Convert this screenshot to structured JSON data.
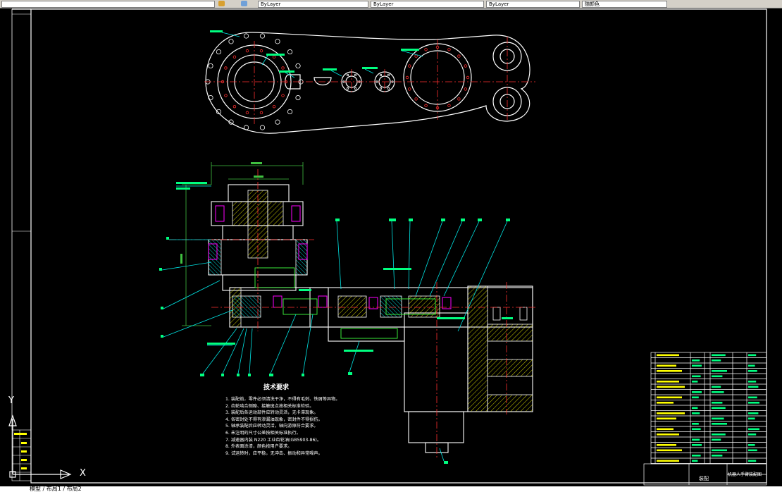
{
  "app": {
    "toolbar": {
      "field1": "",
      "field2": "ByLayer",
      "field3": "ByLayer",
      "field4": "ByLayer",
      "field5": "随颜色"
    },
    "status": {
      "layout_tabs": "模型 / 布局1 / 布局2"
    }
  },
  "drawing": {
    "ucs": {
      "x_label": "X",
      "y_label": "Y"
    },
    "technical_requirements": {
      "title": "技术要求",
      "lines": [
        "1.  装配前，零件必须清洗干净，不得有毛刺、铁屑等异物。",
        "2.  齿轮啮合侧隙、接触斑点按相关标准检验。",
        "3.  装配后各运动部件应转动灵活，无卡滞现象。",
        "4.  各密封处不得有渗漏油现象，密封件不得损伤。",
        "5.  轴承装配后应转动灵活，轴向游隙符合要求。",
        "6.  未注明的尺寸公差按相关标准执行。",
        "7.  减速器内装 N220 工业齿轮油(GB5903-86)。",
        "8.  外表面涂漆，颜色按用户要求。",
        "9.  试运转时，应平稳，无冲击、振动和异常噪声。"
      ]
    },
    "title_block": {
      "drawing_no": "机器人手臂装配图",
      "material": "装配"
    },
    "colors": {
      "outline": "#ffffff",
      "center": "#ff3030",
      "leader": "#00e5e5",
      "dim": "#40c040",
      "text": "#ffff00",
      "hatch": "#00ffff",
      "accent": "#ff00ff",
      "border": "#ffffff"
    }
  }
}
